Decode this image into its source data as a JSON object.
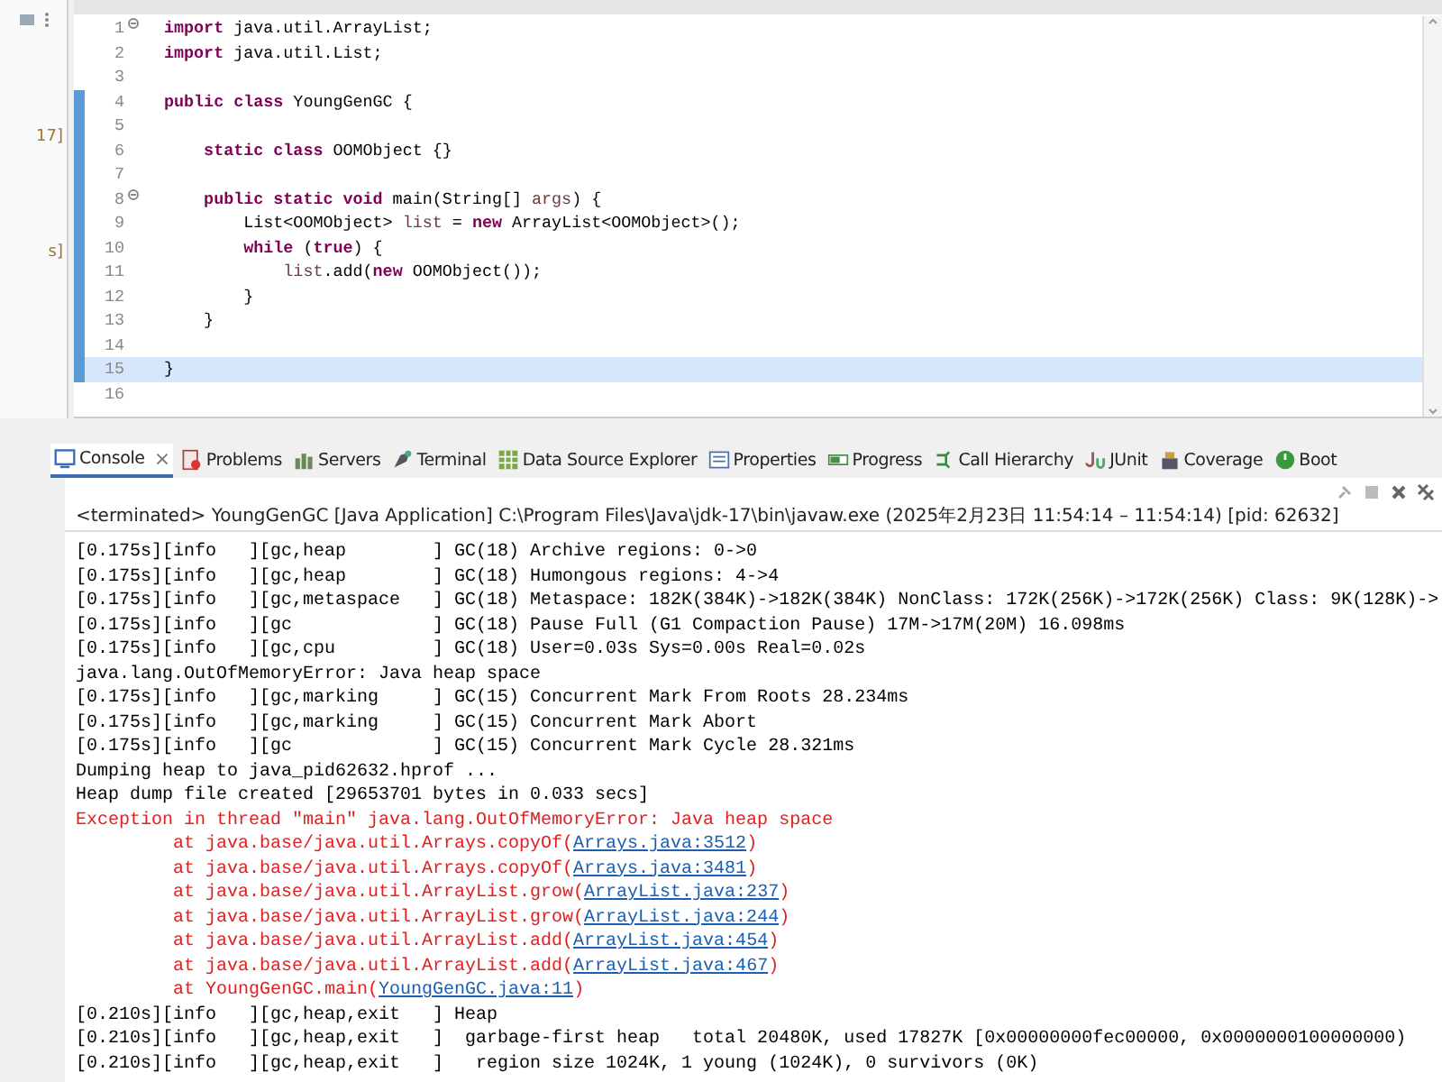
{
  "left_panel": {
    "fragments": [
      "17]",
      "s]"
    ]
  },
  "editor": {
    "lines": [
      {
        "number": "1",
        "fold": true,
        "changed": false,
        "current": false,
        "segments": [
          {
            "text": "import",
            "kind": "keyword"
          },
          {
            "text": " java.util.ArrayList;",
            "kind": "plain"
          }
        ]
      },
      {
        "number": "2",
        "fold": false,
        "changed": false,
        "current": false,
        "segments": [
          {
            "text": "import",
            "kind": "keyword"
          },
          {
            "text": " java.util.List;",
            "kind": "plain"
          }
        ]
      },
      {
        "number": "3",
        "fold": false,
        "changed": false,
        "current": false
      },
      {
        "number": "4",
        "fold": false,
        "changed": true,
        "current": false,
        "segments": [
          {
            "text": "public class",
            "kind": "keyword"
          },
          {
            "text": " YoungGenGC {",
            "kind": "plain"
          }
        ]
      },
      {
        "number": "5",
        "fold": false,
        "changed": true,
        "current": false
      },
      {
        "number": "6",
        "fold": false,
        "changed": true,
        "current": false,
        "segments": [
          {
            "text": "    static class",
            "kind": "keyword"
          },
          {
            "text": " OOMObject {}",
            "kind": "plain"
          }
        ]
      },
      {
        "number": "7",
        "fold": false,
        "changed": true,
        "current": false
      },
      {
        "number": "8",
        "fold": true,
        "changed": true,
        "current": false,
        "segments": [
          {
            "text": "    public static void",
            "kind": "keyword"
          },
          {
            "text": " main(String[] ",
            "kind": "plain"
          },
          {
            "text": "args",
            "kind": "param"
          },
          {
            "text": ") {",
            "kind": "plain"
          }
        ]
      },
      {
        "number": "9",
        "fold": false,
        "changed": true,
        "current": false,
        "segments": [
          {
            "text": "        List<OOMObject> ",
            "kind": "plain"
          },
          {
            "text": "list",
            "kind": "variable"
          },
          {
            "text": " = ",
            "kind": "plain"
          },
          {
            "text": "new",
            "kind": "keyword"
          },
          {
            "text": " ArrayList<OOMObject>();",
            "kind": "plain"
          }
        ]
      },
      {
        "number": "10",
        "fold": false,
        "changed": true,
        "current": false,
        "segments": [
          {
            "text": "        while",
            "kind": "keyword"
          },
          {
            "text": " (",
            "kind": "plain"
          },
          {
            "text": "true",
            "kind": "keyword"
          },
          {
            "text": ") {",
            "kind": "plain"
          }
        ]
      },
      {
        "number": "11",
        "fold": false,
        "changed": true,
        "current": false,
        "segments": [
          {
            "text": "            list",
            "kind": "variable"
          },
          {
            "text": ".add(",
            "kind": "plain"
          },
          {
            "text": "new",
            "kind": "keyword"
          },
          {
            "text": " OOMObject());",
            "kind": "plain"
          }
        ]
      },
      {
        "number": "12",
        "fold": false,
        "changed": true,
        "current": false,
        "segments": [
          {
            "text": "        }",
            "kind": "plain"
          }
        ]
      },
      {
        "number": "13",
        "fold": false,
        "changed": true,
        "current": false,
        "segments": [
          {
            "text": "    }",
            "kind": "plain"
          }
        ]
      },
      {
        "number": "14",
        "fold": false,
        "changed": true,
        "current": false
      },
      {
        "number": "15",
        "fold": false,
        "changed": true,
        "current": true,
        "segments": [
          {
            "text": "}",
            "kind": "plain"
          }
        ]
      },
      {
        "number": "16",
        "fold": false,
        "changed": false,
        "current": false
      }
    ]
  },
  "views": {
    "tabs": [
      {
        "label": "Console",
        "selected": true,
        "close": "×"
      },
      {
        "label": "Problems",
        "selected": false
      },
      {
        "label": "Servers",
        "selected": false
      },
      {
        "label": "Terminal",
        "selected": false
      },
      {
        "label": "Data Source Explorer",
        "selected": false
      },
      {
        "label": "Properties",
        "selected": false
      },
      {
        "label": "Progress",
        "selected": false
      },
      {
        "label": "Call Hierarchy",
        "selected": false
      },
      {
        "label": "JUnit",
        "selected": false
      },
      {
        "label": "Coverage",
        "selected": false
      },
      {
        "label": "Boot",
        "selected": false
      }
    ]
  },
  "console": {
    "header": "<terminated> YoungGenGC [Java Application] C:\\Program Files\\Java\\jdk-17\\bin\\javaw.exe  (2025年2月23日 11:54:14 – 11:54:14) [pid: 62632]",
    "lines": [
      {
        "kind": "log",
        "text": "[0.175s][info   ][gc,heap        ] GC(18) Archive regions: 0->0"
      },
      {
        "kind": "log",
        "text": "[0.175s][info   ][gc,heap        ] GC(18) Humongous regions: 4->4"
      },
      {
        "kind": "log",
        "text": "[0.175s][info   ][gc,metaspace   ] GC(18) Metaspace: 182K(384K)->182K(384K) NonClass: 172K(256K)->172K(256K) Class: 9K(128K)->"
      },
      {
        "kind": "log",
        "text": "[0.175s][info   ][gc             ] GC(18) Pause Full (G1 Compaction Pause) 17M->17M(20M) 16.098ms"
      },
      {
        "kind": "log",
        "text": "[0.175s][info   ][gc,cpu         ] GC(18) User=0.03s Sys=0.00s Real=0.02s"
      },
      {
        "kind": "log",
        "text": "java.lang.OutOfMemoryError: Java heap space"
      },
      {
        "kind": "log",
        "text": "[0.175s][info   ][gc,marking     ] GC(15) Concurrent Mark From Roots 28.234ms"
      },
      {
        "kind": "log",
        "text": "[0.175s][info   ][gc,marking     ] GC(15) Concurrent Mark Abort"
      },
      {
        "kind": "log",
        "text": "[0.175s][info   ][gc             ] GC(15) Concurrent Mark Cycle 28.321ms"
      },
      {
        "kind": "log",
        "text": "Dumping heap to java_pid62632.hprof ..."
      },
      {
        "kind": "log",
        "text": "Heap dump file created [29653701 bytes in 0.033 secs]"
      },
      {
        "kind": "error",
        "text": "Exception in thread \"main\" java.lang.OutOfMemoryError: Java heap space"
      },
      {
        "kind": "trace",
        "text": "at java.base/java.util.Arrays.copyOf(",
        "link": "Arrays.java:3512",
        "after": ")"
      },
      {
        "kind": "trace",
        "text": "at java.base/java.util.Arrays.copyOf(",
        "link": "Arrays.java:3481",
        "after": ")"
      },
      {
        "kind": "trace",
        "text": "at java.base/java.util.ArrayList.grow(",
        "link": "ArrayList.java:237",
        "after": ")"
      },
      {
        "kind": "trace",
        "text": "at java.base/java.util.ArrayList.grow(",
        "link": "ArrayList.java:244",
        "after": ")"
      },
      {
        "kind": "trace",
        "text": "at java.base/java.util.ArrayList.add(",
        "link": "ArrayList.java:454",
        "after": ")"
      },
      {
        "kind": "trace",
        "text": "at java.base/java.util.ArrayList.add(",
        "link": "ArrayList.java:467",
        "after": ")"
      },
      {
        "kind": "trace",
        "text": "at YoungGenGC.main(",
        "link": "YoungGenGC.java:11",
        "after": ")"
      },
      {
        "kind": "log",
        "text": "[0.210s][info   ][gc,heap,exit   ] Heap"
      },
      {
        "kind": "log",
        "text": "[0.210s][info   ][gc,heap,exit   ]  garbage-first heap   total 20480K, used 17827K [0x00000000fec00000, 0x0000000100000000)"
      },
      {
        "kind": "log",
        "text": "[0.210s][info   ][gc,heap,exit   ]   region size 1024K, 1 young (1024K), 0 survivors (0K)"
      }
    ]
  }
}
